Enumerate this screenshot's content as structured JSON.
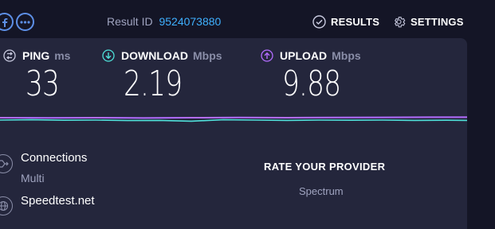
{
  "header": {
    "result_id_label": "Result ID",
    "result_id_value": "9524073880",
    "results_label": "RESULTS",
    "settings_label": "SETTINGS"
  },
  "metrics": {
    "ping": {
      "label": "PING",
      "unit": "ms",
      "value": "33",
      "icon": "ping-icon",
      "color": "#ffffff"
    },
    "download": {
      "label": "DOWNLOAD",
      "unit": "Mbps",
      "value": "2.19",
      "icon": "download-icon",
      "color": "#4ee0d8"
    },
    "upload": {
      "label": "UPLOAD",
      "unit": "Mbps",
      "value": "9.88",
      "icon": "upload-icon",
      "color": "#b36dff"
    }
  },
  "details": {
    "connections_title": "Connections",
    "connections_value": "Multi",
    "server_title": "Speedtest.net"
  },
  "rate": {
    "title": "RATE YOUR PROVIDER",
    "provider": "Spectrum"
  },
  "colors": {
    "background": "#141526",
    "panel": "#24263c",
    "accent_link": "#3fb0ff",
    "download": "#4ee0d8",
    "upload": "#b36dff"
  }
}
